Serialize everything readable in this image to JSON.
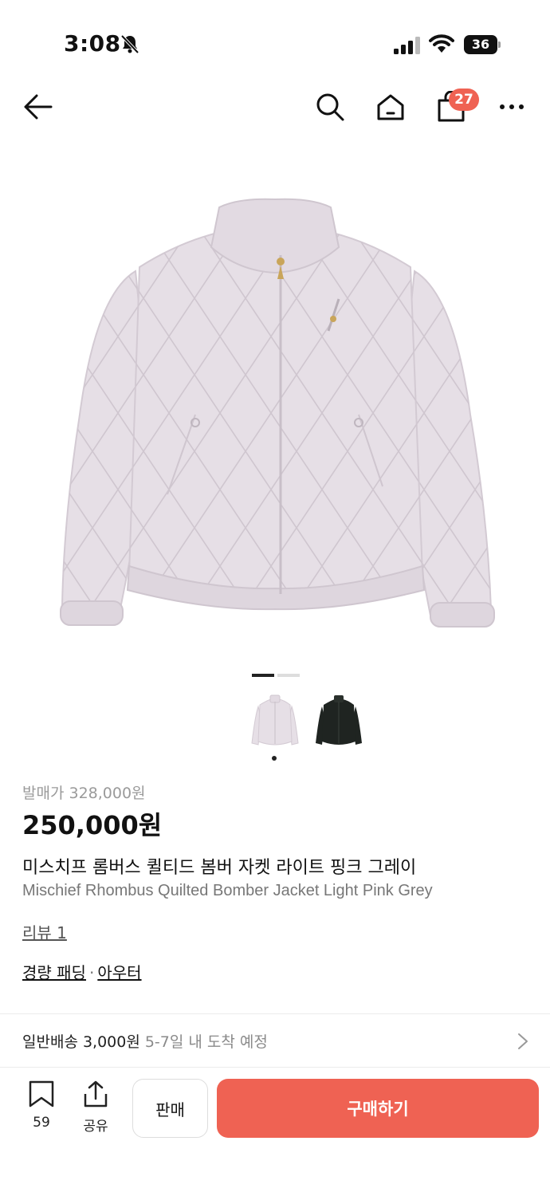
{
  "status_bar": {
    "time": "3:08",
    "battery": "36"
  },
  "nav": {
    "cart_count": "27"
  },
  "product": {
    "release_price": "발매가 328,000원",
    "price": "250,000원",
    "title_ko": "미스치프 롬버스 퀼티드 봄버 자켓 라이트 핑크 그레이",
    "title_en": "Mischief Rhombus Quilted Bomber Jacket Light Pink Grey",
    "review_link": "리뷰 1",
    "categories": [
      "경량 패딩",
      "아우터"
    ],
    "category_separator": "·"
  },
  "shipping": {
    "main": "일반배송 3,000원",
    "eta": "5-7일 내 도착 예정"
  },
  "bottom_bar": {
    "wishlist_count": "59",
    "share_label": "공유",
    "sell_label": "판매",
    "buy_label": "구매하기"
  },
  "colors": {
    "accent": "#ef6253",
    "jacket": "#e6dfe6",
    "thumb_dark": "#1f2421"
  }
}
